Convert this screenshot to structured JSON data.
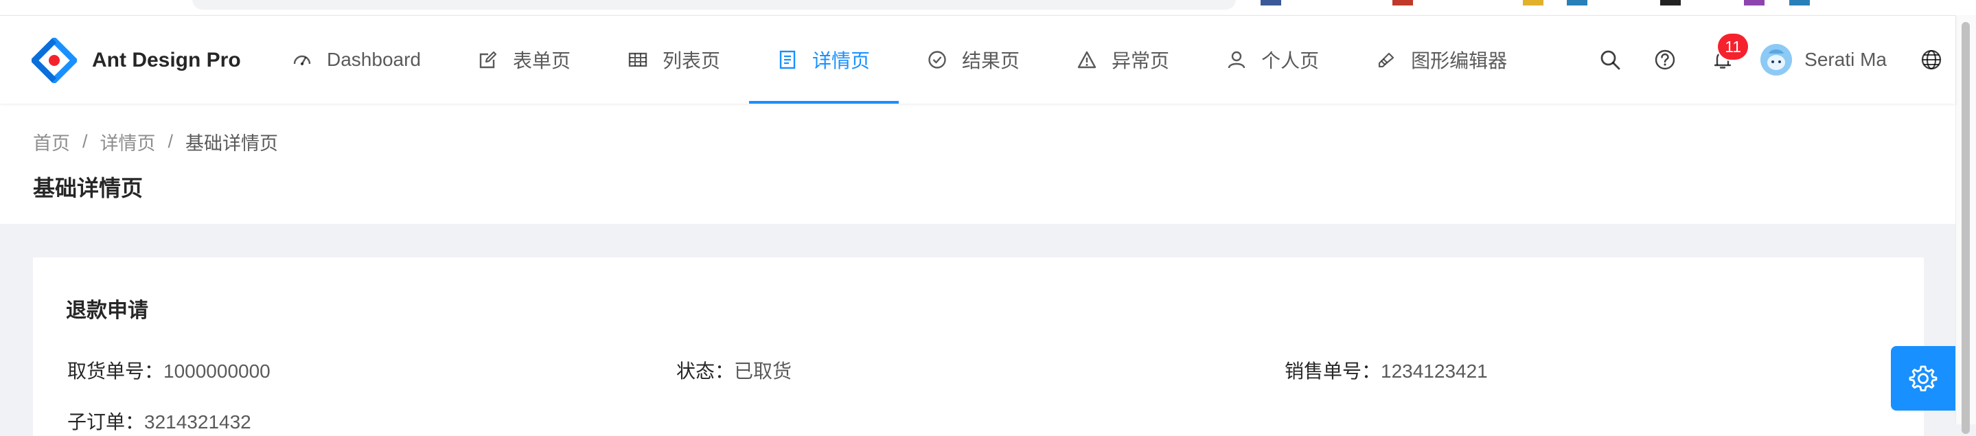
{
  "app": {
    "title": "Ant Design Pro"
  },
  "nav": {
    "items": [
      {
        "label": "Dashboard",
        "icon": "dashboard-icon"
      },
      {
        "label": "表单页",
        "icon": "form-icon"
      },
      {
        "label": "列表页",
        "icon": "table-icon"
      },
      {
        "label": "详情页",
        "icon": "profile-icon",
        "active": true
      },
      {
        "label": "结果页",
        "icon": "check-circle-icon"
      },
      {
        "label": "异常页",
        "icon": "warning-icon"
      },
      {
        "label": "个人页",
        "icon": "user-icon"
      },
      {
        "label": "图形编辑器",
        "icon": "highlight-icon"
      }
    ]
  },
  "header": {
    "notification_count": "11",
    "user_name": "Serati Ma"
  },
  "breadcrumb": {
    "items": [
      "首页",
      "详情页",
      "基础详情页"
    ],
    "separator": "/"
  },
  "page": {
    "title": "基础详情页"
  },
  "card": {
    "title": "退款申请",
    "fields": [
      {
        "label": "取货单号：",
        "value": "1000000000"
      },
      {
        "label": "状态：",
        "value": "已取货"
      },
      {
        "label": "销售单号：",
        "value": "1234123421"
      },
      {
        "label": "子订单：",
        "value": "3214321432"
      }
    ]
  },
  "colors": {
    "primary": "#1890ff",
    "badge": "#f5222d",
    "background": "#f0f2f5"
  }
}
